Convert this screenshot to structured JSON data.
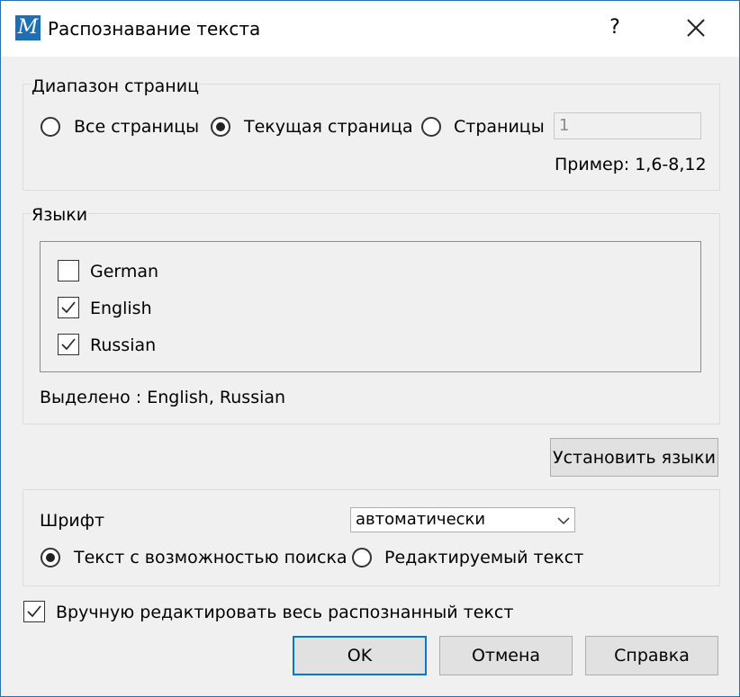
{
  "window": {
    "title": "Распознавание текста",
    "app_icon_letter": "M",
    "help_label": "?"
  },
  "page_range": {
    "legend": "Диапазон страниц",
    "options": [
      {
        "label": "Все страницы",
        "selected": false
      },
      {
        "label": "Текущая страница",
        "selected": true
      },
      {
        "label": "Страницы",
        "selected": false
      }
    ],
    "pages_value": "1",
    "example": "Пример: 1,6-8,12"
  },
  "languages": {
    "legend": "Языки",
    "items": [
      {
        "label": "German",
        "checked": false
      },
      {
        "label": "English",
        "checked": true
      },
      {
        "label": "Russian",
        "checked": true
      }
    ],
    "selected_text": "Выделено : English, Russian",
    "install_button": "Установить языки"
  },
  "font": {
    "label": "Шрифт",
    "selected": "автоматически",
    "modes": [
      {
        "label": "Текст с возможностью поиска",
        "selected": true
      },
      {
        "label": "Редактируемый текст",
        "selected": false
      }
    ]
  },
  "manual_edit": {
    "label": "Вручную редактировать весь распознанный текст",
    "checked": true
  },
  "buttons": {
    "ok": "OK",
    "cancel": "Отмена",
    "help": "Справка"
  },
  "colors": {
    "accent": "#0078d7",
    "window_border": "#2b6fb3",
    "dialog_bg": "#f0f0f0"
  }
}
